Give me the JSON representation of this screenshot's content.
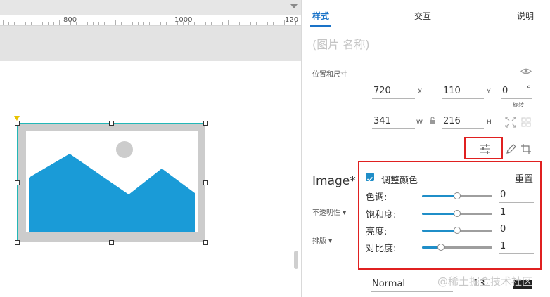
{
  "canvas": {
    "ruler_labels": [
      "800",
      "1000",
      "120"
    ]
  },
  "panel": {
    "tabs": {
      "style": "样式",
      "interaction": "交互",
      "notes": "说明"
    },
    "image_name_placeholder": "(图片 名称)",
    "position_size": {
      "label": "位置和尺寸",
      "x_value": "720",
      "x_label": "X",
      "y_value": "110",
      "y_label": "Y",
      "rotation_value": "0",
      "rotation_unit": "°",
      "rotation_label": "旋转",
      "w_value": "341",
      "w_label": "W",
      "h_value": "216",
      "h_label": "H"
    },
    "image_heading": "Image*",
    "opacity_label": "不透明性 ▾",
    "layout_label": "排版 ▾",
    "adjust_color": {
      "title": "调整颜色",
      "reset": "重置",
      "checked": true,
      "accent_color": "#1f8ec8",
      "rows": [
        {
          "label": "色调:",
          "value": "0",
          "fraction": 0.5
        },
        {
          "label": "饱和度:",
          "value": "1",
          "fraction": 0.5
        },
        {
          "label": "亮度:",
          "value": "0",
          "fraction": 0.5
        },
        {
          "label": "对比度:",
          "value": "1",
          "fraction": 0.27
        }
      ]
    },
    "blend_mode": "Normal",
    "font_size": "13",
    "swatch_color": "#222222"
  },
  "watermark": "@稀土掘金技术社区",
  "colors": {
    "highlight": "#e02020",
    "selection_border": "#23b7b7",
    "image_fill": "#1a9bd7",
    "active_tab": "#1a73c8"
  }
}
